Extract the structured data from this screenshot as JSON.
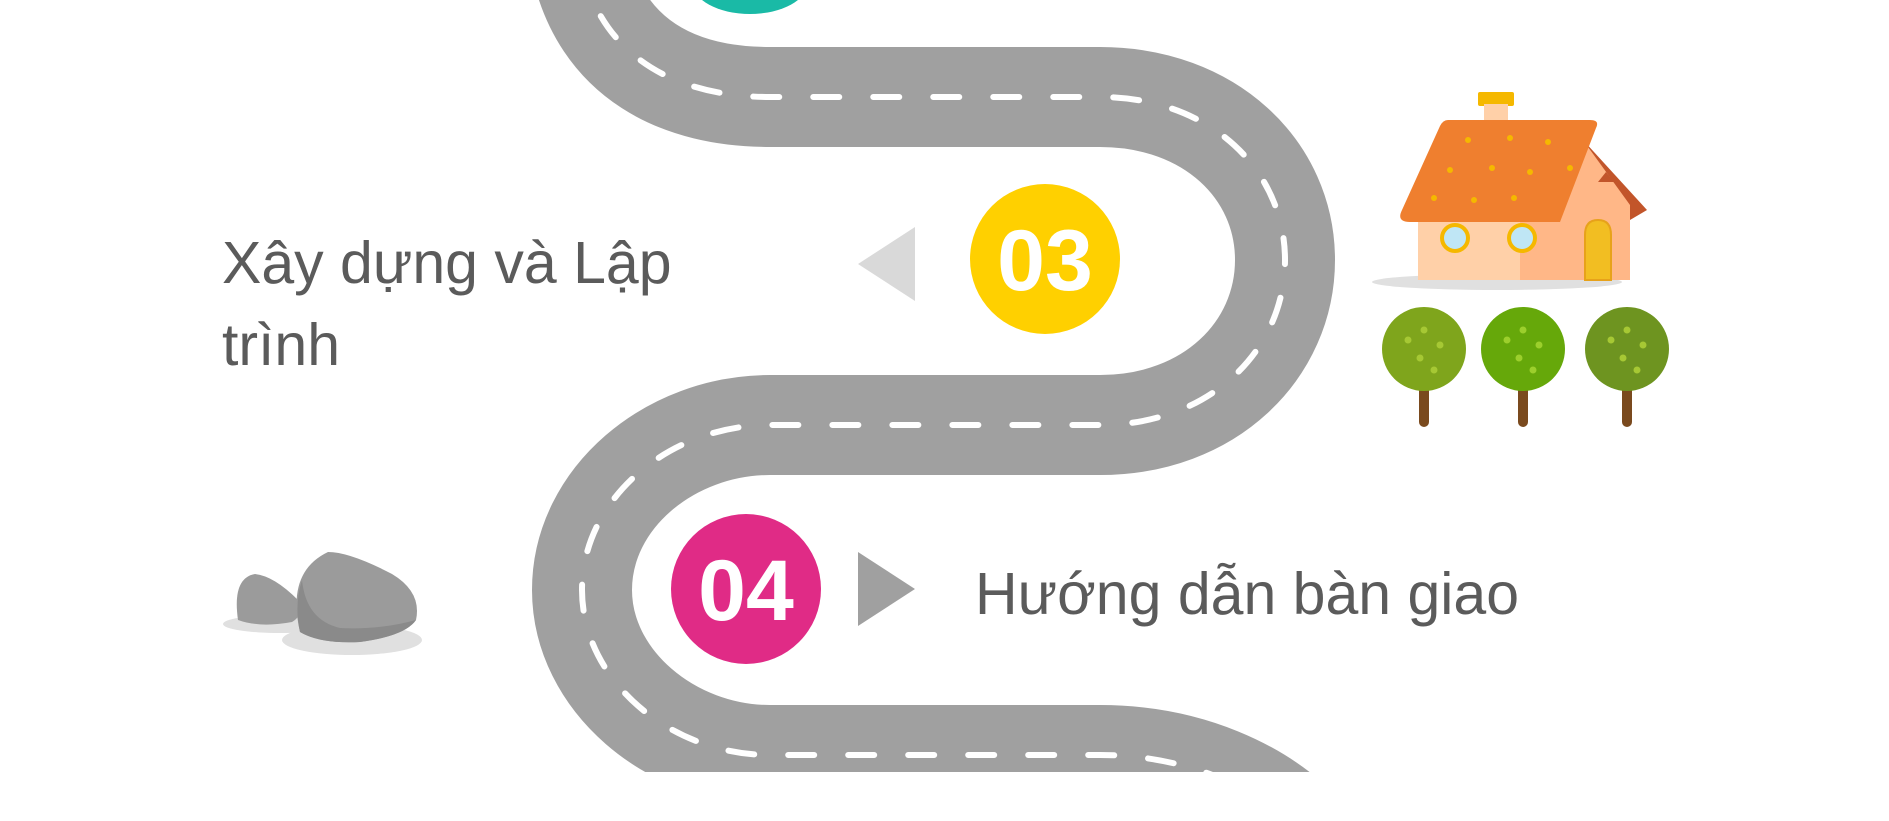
{
  "steps": [
    {
      "number": "03",
      "label_lines": [
        "Xây dựng và Lập",
        "trình"
      ],
      "color": "#ffd000"
    },
    {
      "number": "04",
      "label_lines": [
        "Hướng dẫn bàn giao"
      ],
      "color": "#e02b86"
    }
  ],
  "road": {
    "asphalt": "#a0a0a0",
    "dash": "#ffffff"
  },
  "arrows": {
    "left_color": "#d9d9d9",
    "right_color": "#a0a0a0"
  },
  "decorations": {
    "house_roof": "#ef7f2f",
    "house_wall": "#ffd0a8",
    "tree_foliage": [
      "#7fa51c",
      "#66a80a",
      "#6e9420"
    ],
    "tree_trunk": "#7a4a1e",
    "rock": "#9b9b9b",
    "partial_circle_top": "#1abaa6"
  }
}
